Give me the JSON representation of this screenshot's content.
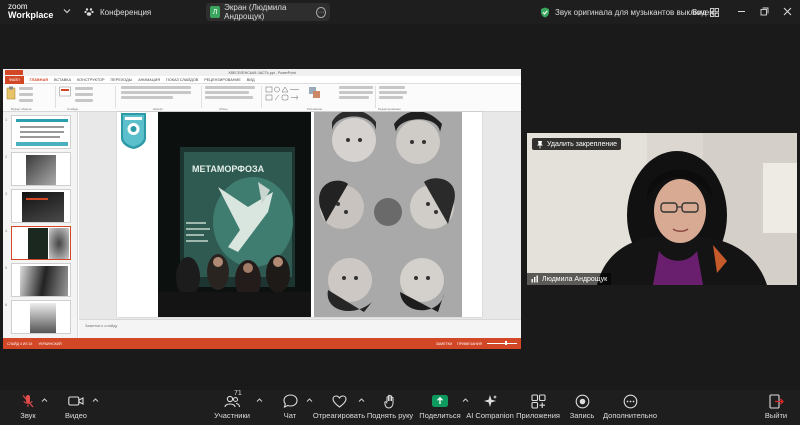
{
  "topbar": {
    "logo_line1": "zoom",
    "logo_line2": "Workplace",
    "meeting_title": "Конференция",
    "share_initial": "Л",
    "share_label": "Экран (Людмила Андрощук)",
    "audio_status": "Звук оригинала для музыкантов выключен",
    "view_label": "Вид",
    "colors": {
      "shield": "#3aa55d",
      "avatar": "#3aa55d"
    }
  },
  "powerpoint": {
    "window_title": "ХВЕСЕЛЕНСЬКА ЧАСТЬ.ppt - PowerPoint",
    "tabs": [
      "ФАЙЛ",
      "ГЛАВНАЯ",
      "ВСТАВКА",
      "КОНСТРУКТОР",
      "ПЕРЕХОДЫ",
      "АНИМАЦИЯ",
      "ПОКАЗ СЛАЙДОВ",
      "РЕЦЕНЗИРОВАНИЕ",
      "ВИД"
    ],
    "active_tab": 1,
    "ribbon_labels": [
      "Буфер обмена",
      "Слайды",
      "Шрифт",
      "Абзац",
      "Рисование",
      "Редактирование"
    ],
    "slide_numbers": [
      "1",
      "2",
      "3",
      "4",
      "5",
      "6"
    ],
    "selected_slide": 4,
    "poster_text": "МЕТАМОРФОЗА",
    "notes_placeholder": "Заметки к слайду",
    "status_left": "СЛАЙД 4 ИЗ 15",
    "status_lang": "УКРАИНСКИЙ",
    "status_notes": "ЗАМЕТКИ",
    "status_comments": "ПРИМЕЧАНИЯ",
    "accent_color": "#d24726"
  },
  "video": {
    "unpin_label": "Удалить закрепление",
    "participant_name": "Людмила Андрощук"
  },
  "toolbar": {
    "items": [
      {
        "label": "Звук",
        "icon": "mic-muted-icon"
      },
      {
        "label": "Видео",
        "icon": "video-icon"
      },
      {
        "label": "Участники",
        "icon": "participants-icon",
        "count": "71"
      },
      {
        "label": "Чат",
        "icon": "chat-icon"
      },
      {
        "label": "Отреагировать",
        "icon": "heart-icon"
      },
      {
        "label": "Поднять руку",
        "icon": "hand-icon"
      },
      {
        "label": "Поделиться",
        "icon": "share-screen-icon"
      },
      {
        "label": "AI Companion",
        "icon": "ai-companion-icon"
      },
      {
        "label": "Приложения",
        "icon": "apps-icon"
      },
      {
        "label": "Запись",
        "icon": "record-icon"
      },
      {
        "label": "Дополнительно",
        "icon": "more-icon"
      },
      {
        "label": "Выйти",
        "icon": "leave-icon"
      }
    ],
    "share_color": "#0e9a5f",
    "leave_color": "#e02828"
  }
}
